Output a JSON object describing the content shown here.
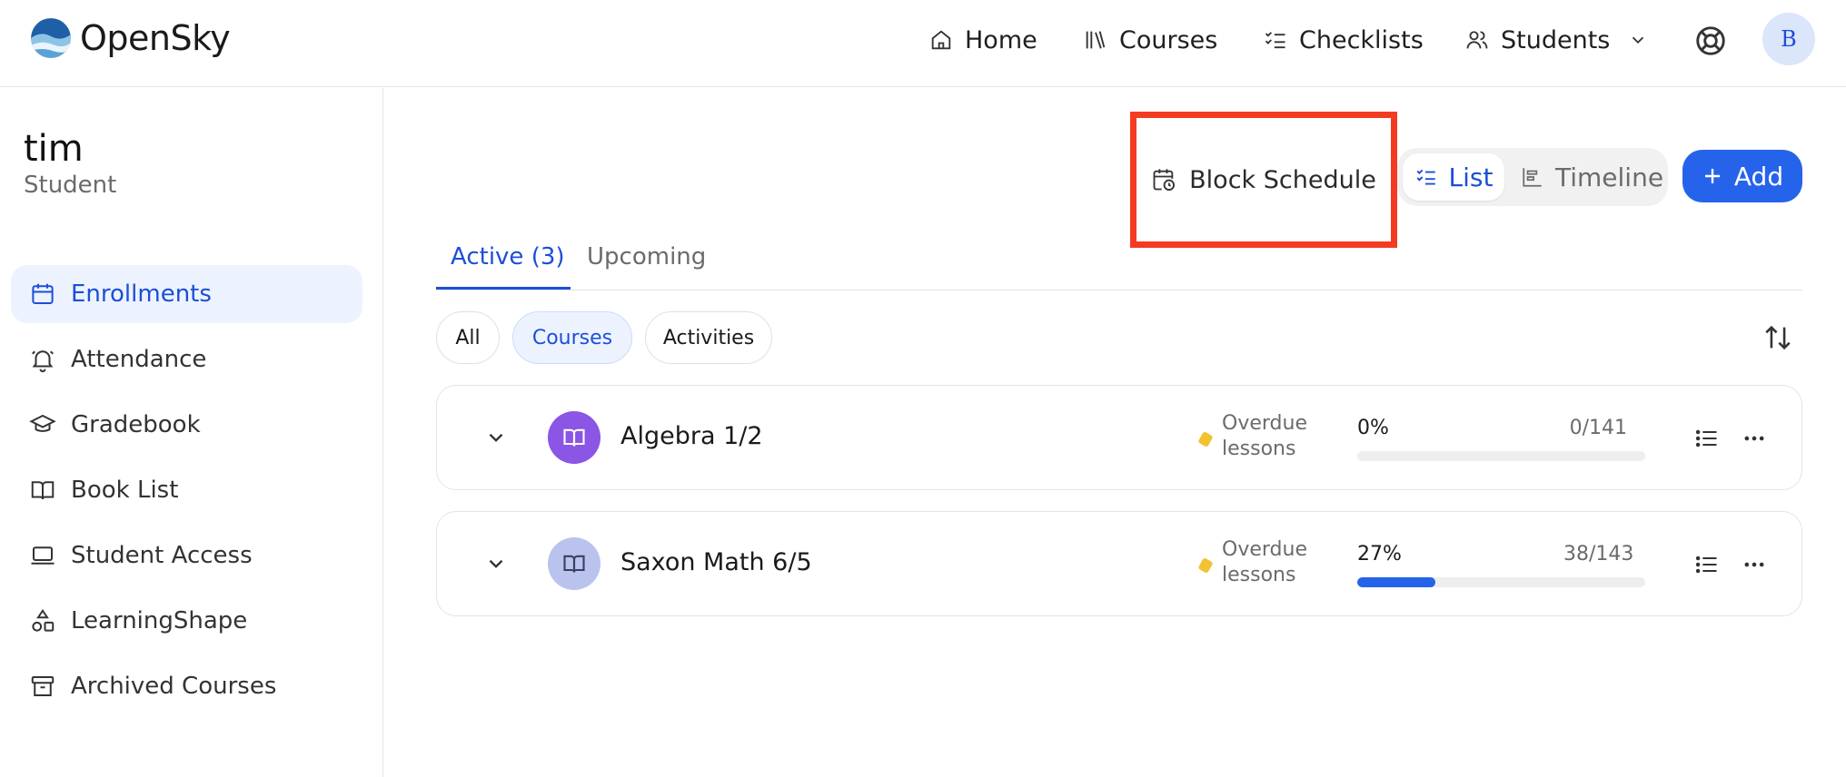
{
  "app": {
    "name": "OpenSky"
  },
  "nav": {
    "home": "Home",
    "courses": "Courses",
    "checklists": "Checklists",
    "students": "Students"
  },
  "user": {
    "avatar_initial": "B"
  },
  "student": {
    "name": "tim",
    "role": "Student"
  },
  "sidebar": {
    "items": [
      {
        "label": "Enrollments",
        "icon": "calendar-icon",
        "active": true
      },
      {
        "label": "Attendance",
        "icon": "bell-icon"
      },
      {
        "label": "Gradebook",
        "icon": "graduation-cap-icon"
      },
      {
        "label": "Book List",
        "icon": "open-book-icon"
      },
      {
        "label": "Student Access",
        "icon": "laptop-icon"
      },
      {
        "label": "LearningShape",
        "icon": "shapes-icon"
      },
      {
        "label": "Archived Courses",
        "icon": "archive-icon"
      }
    ]
  },
  "toolbar": {
    "block_schedule": "Block Schedule",
    "view_list": "List",
    "view_timeline": "Timeline",
    "add": "Add"
  },
  "tabs": {
    "active": "Active (3)",
    "upcoming": "Upcoming"
  },
  "filters": {
    "all": "All",
    "courses": "Courses",
    "activities": "Activities",
    "selected": "Courses"
  },
  "courses": [
    {
      "title": "Algebra 1/2",
      "status_line1": "Overdue",
      "status_line2": "lessons",
      "percent": "0%",
      "progress": 0.0,
      "count": "0/141",
      "icon_color": "#8b55e6"
    },
    {
      "title": "Saxon Math 6/5",
      "status_line1": "Overdue",
      "status_line2": "lessons",
      "percent": "27%",
      "progress": 0.27,
      "count": "38/143",
      "icon_color": "#b9c3ee"
    }
  ],
  "colors": {
    "accent": "#2563eb",
    "highlight_border": "#f53a22",
    "overdue": "#f2c233"
  }
}
